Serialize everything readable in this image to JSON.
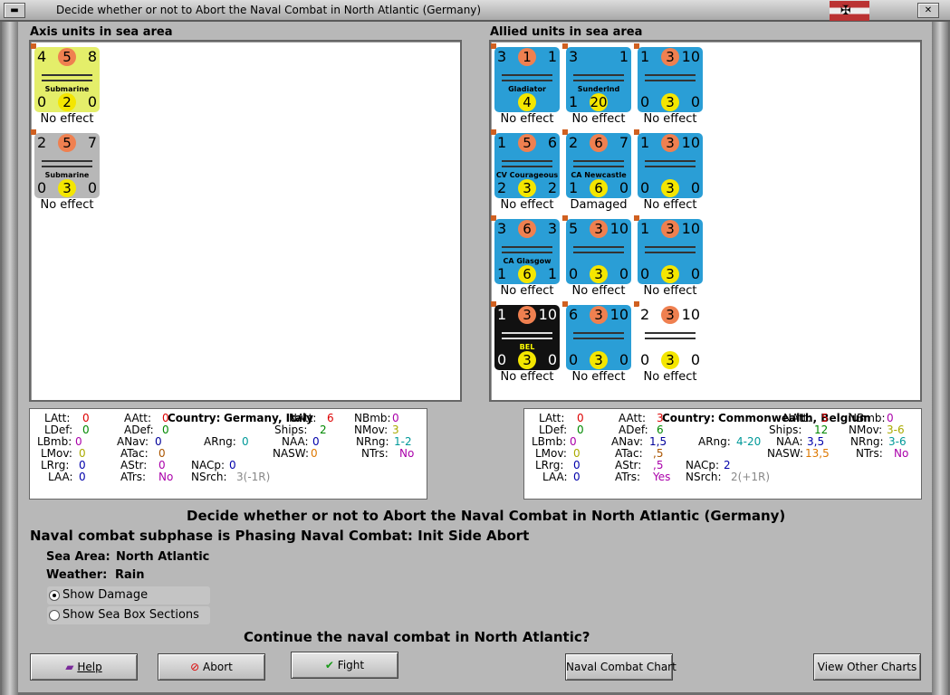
{
  "window": {
    "title": "Decide whether or not to Abort the Naval Combat in North Atlantic (Germany)"
  },
  "axis": {
    "heading": "Axis units in sea area",
    "units": [
      {
        "top_left": "4",
        "top_mid": "5",
        "top_right": "8",
        "name": "Submarine",
        "bot_left": "0",
        "bot_mid": "2",
        "bot_right": "0",
        "status": "No effect",
        "color": "#e4ee6a"
      },
      {
        "top_left": "2",
        "top_mid": "5",
        "top_right": "7",
        "name": "Submarine",
        "bot_left": "0",
        "bot_mid": "3",
        "bot_right": "0",
        "status": "No effect",
        "color": "#b7b7b7"
      }
    ]
  },
  "allied": {
    "heading": "Allied units in sea area",
    "units": [
      {
        "top_left": "3",
        "top_mid": "1",
        "top_right": "1",
        "name": "Gladiator",
        "bot_left": "",
        "bot_mid": "4",
        "bot_right": "",
        "status": "No effect",
        "color": "#2a9ed6"
      },
      {
        "top_left": "3",
        "top_mid": "",
        "top_right": "1",
        "name": "Sunderlnd",
        "bot_left": "1",
        "bot_mid": "20",
        "bot_right": "",
        "status": "No effect",
        "color": "#2a9ed6"
      },
      {
        "top_left": "1",
        "top_mid": "3",
        "top_right": "10",
        "name": "",
        "bot_left": "0",
        "bot_mid": "3",
        "bot_right": "0",
        "status": "No effect",
        "color": "#2a9ed6"
      },
      {
        "top_left": "1",
        "top_mid": "5",
        "top_right": "6",
        "name": "CV Courageous",
        "bot_left": "2",
        "bot_mid": "3",
        "bot_right": "2",
        "status": "No effect",
        "color": "#2a9ed6"
      },
      {
        "top_left": "2",
        "top_mid": "6",
        "top_right": "7",
        "name": "CA Newcastle",
        "bot_left": "1",
        "bot_mid": "6",
        "bot_right": "0",
        "status": "Damaged",
        "color": "#2a9ed6"
      },
      {
        "top_left": "1",
        "top_mid": "3",
        "top_right": "10",
        "name": "",
        "bot_left": "0",
        "bot_mid": "3",
        "bot_right": "0",
        "status": "No effect",
        "color": "#2a9ed6"
      },
      {
        "top_left": "3",
        "top_mid": "6",
        "top_right": "3",
        "name": "CA Glasgow",
        "bot_left": "1",
        "bot_mid": "6",
        "bot_right": "1",
        "status": "No effect",
        "color": "#2a9ed6"
      },
      {
        "top_left": "5",
        "top_mid": "3",
        "top_right": "10",
        "name": "",
        "bot_left": "0",
        "bot_mid": "3",
        "bot_right": "0",
        "status": "No effect",
        "color": "#2a9ed6"
      },
      {
        "top_left": "1",
        "top_mid": "3",
        "top_right": "10",
        "name": "",
        "bot_left": "0",
        "bot_mid": "3",
        "bot_right": "0",
        "status": "No effect",
        "color": "#2a9ed6"
      },
      {
        "top_left": "1",
        "top_mid": "3",
        "top_right": "10",
        "name": "BEL",
        "bot_left": "0",
        "bot_mid": "3",
        "bot_right": "0",
        "status": "No effect",
        "color": "#111111"
      },
      {
        "top_left": "6",
        "top_mid": "3",
        "top_right": "10",
        "name": "",
        "bot_left": "0",
        "bot_mid": "3",
        "bot_right": "0",
        "status": "No effect",
        "color": "#2a9ed6"
      },
      {
        "top_left": "2",
        "top_mid": "3",
        "top_right": "10",
        "name": "",
        "bot_left": "0",
        "bot_mid": "3",
        "bot_right": "0",
        "status": "No effect",
        "color": "#ffffff"
      }
    ]
  },
  "axis_stats": {
    "country_label": "Country:",
    "country": "Germany, Italy",
    "LAtt": "0",
    "AAtt": "0",
    "LDef": "0",
    "ADef": "0",
    "LBmb": "0",
    "ANav": "0",
    "ARng": "0",
    "LMov": "0",
    "ATac": "0",
    "LRrg": "0",
    "AStr": "0",
    "NACp": "0",
    "LAA": "0",
    "ATrs": "No",
    "NAtt": "6",
    "NBmb": "0",
    "Ships": "2",
    "NMov": "3",
    "NAA": "0",
    "NRng": "1-2",
    "NASW": "0",
    "NTrs": "No",
    "NSrch": "3(-1R)"
  },
  "allied_stats": {
    "country_label": "Country:",
    "country": "Commonwealth, Belgium",
    "LAtt": "0",
    "AAtt": "3",
    "LDef": "0",
    "ADef": "6",
    "LBmb": "0",
    "ANav": "1,5",
    "ARng": "4-20",
    "LMov": "0",
    "ATac": ",5",
    "LRrg": "0",
    "AStr": ",5",
    "NACp": "2",
    "LAA": "0",
    "ATrs": "Yes",
    "NAtt": "5",
    "NBmb": "0",
    "Ships": "12",
    "NMov": "3-6",
    "NAA": "3,5",
    "NRng": "3-6",
    "NASW": "13,5",
    "NTrs": "No",
    "NSrch": "2(+1R)"
  },
  "decision": {
    "headline": "Decide whether or not to Abort the Naval Combat in North Atlantic (Germany)",
    "subphase": "Naval combat subphase is Phasing Naval Combat: Init Side Abort",
    "sea_area_label": "Sea Area:",
    "sea_area": "North Atlantic",
    "weather_label": "Weather:",
    "weather": "Rain",
    "show_damage": "Show Damage",
    "show_sea_box": "Show Sea Box Sections",
    "question": "Continue the naval combat in North Atlantic?"
  },
  "buttons": {
    "help": "Help",
    "abort": "Abort",
    "fight": "Fight",
    "naval_chart": "Naval Combat Chart",
    "other_charts": "View Other Charts"
  }
}
